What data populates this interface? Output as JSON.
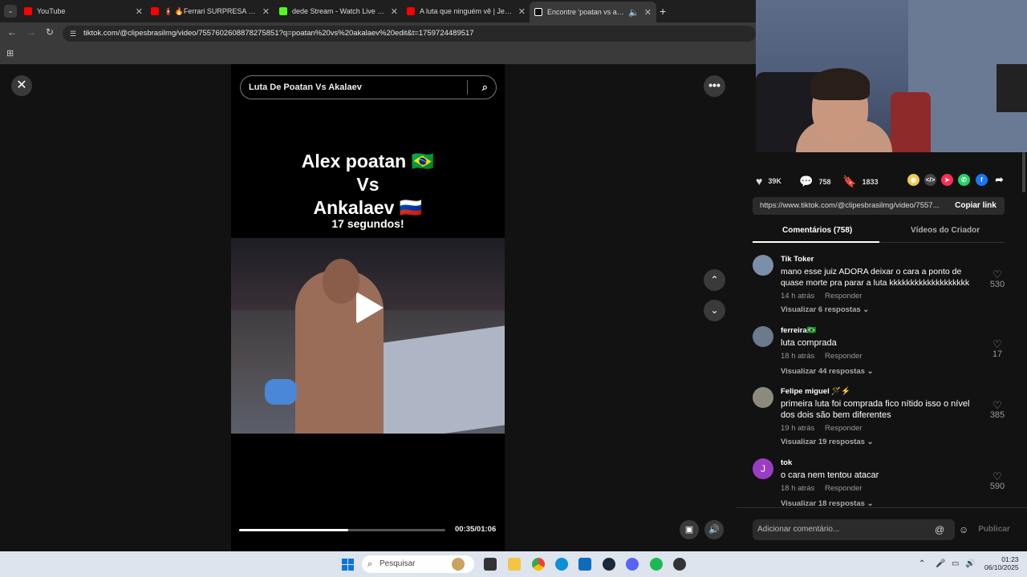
{
  "browser": {
    "tabs": [
      {
        "label": "YouTube",
        "color": "#ff0000"
      },
      {
        "label": "🧯 🔥Ferrari SURPRESA com as",
        "color": "#ff0000"
      },
      {
        "label": "dede Stream - Watch Live on K",
        "color": "#53fc18"
      },
      {
        "label": "A luta que ninguém vê | Jean S",
        "color": "#ff0000"
      },
      {
        "label": "Encontre 'poatan vs akalae",
        "color": "#ffffff"
      }
    ],
    "url": "tiktok.com/@clipesbrasilmg/video/7557602608878275851?q=poatan%20vs%20akalaev%20edit&t=1759724489517"
  },
  "player": {
    "search_query": "Luta De Poatan Vs Akalaev",
    "overlay_line1": "Alex poatan 🇧🇷",
    "overlay_line2": "Vs",
    "overlay_line3": "Ankalaev 🇷🇺",
    "overlay_line4": "17 segundos!",
    "time": "00:35/01:06",
    "progress": 0.53
  },
  "stats": {
    "likes": "39K",
    "comments": "758",
    "saves": "1833"
  },
  "share": {
    "link": "https://www.tiktok.com/@clipesbrasilmg/video/7557...",
    "copy_label": "Copiar link"
  },
  "panel_tabs": {
    "comments": "Comentários (758)",
    "creator": "Vídeos do Criador"
  },
  "comments": [
    {
      "name": "Tik Toker",
      "text": "mano esse juiz ADORA deixar o cara a ponto de quase morte pra parar a luta kkkkkkkkkkkkkkkkkkk",
      "time": "14 h atrás",
      "reply": "Responder",
      "replies": "Visualizar 6 respostas",
      "likes": "530",
      "avatar_color": "#7a8fa8"
    },
    {
      "name": "ferreira🇧🇷",
      "text": "luta comprada",
      "time": "18 h atrás",
      "reply": "Responder",
      "replies": "Visualizar 44 respostas",
      "likes": "17",
      "avatar_color": "#6b7a8c"
    },
    {
      "name": "Felipe miguel 🪄⚡",
      "text": "primeira luta foi comprada fico nítido isso o nível dos dois são bem diferentes",
      "time": "19 h atrás",
      "reply": "Responder",
      "replies": "Visualizar 19 respostas",
      "likes": "385",
      "avatar_color": "#8b8a7d"
    },
    {
      "name": "tok",
      "text": "o cara nem tentou atacar",
      "time": "18 h atrás",
      "reply": "Responder",
      "replies": "Visualizar 18 respostas",
      "likes": "590",
      "avatar_color": "#9b3dc4",
      "initial": "J"
    }
  ],
  "comment_input": {
    "placeholder": "Adicionar comentário...",
    "submit": "Publicar"
  },
  "taskbar": {
    "search_placeholder": "Pesquisar",
    "time": "01:23",
    "date": "06/10/2025"
  }
}
